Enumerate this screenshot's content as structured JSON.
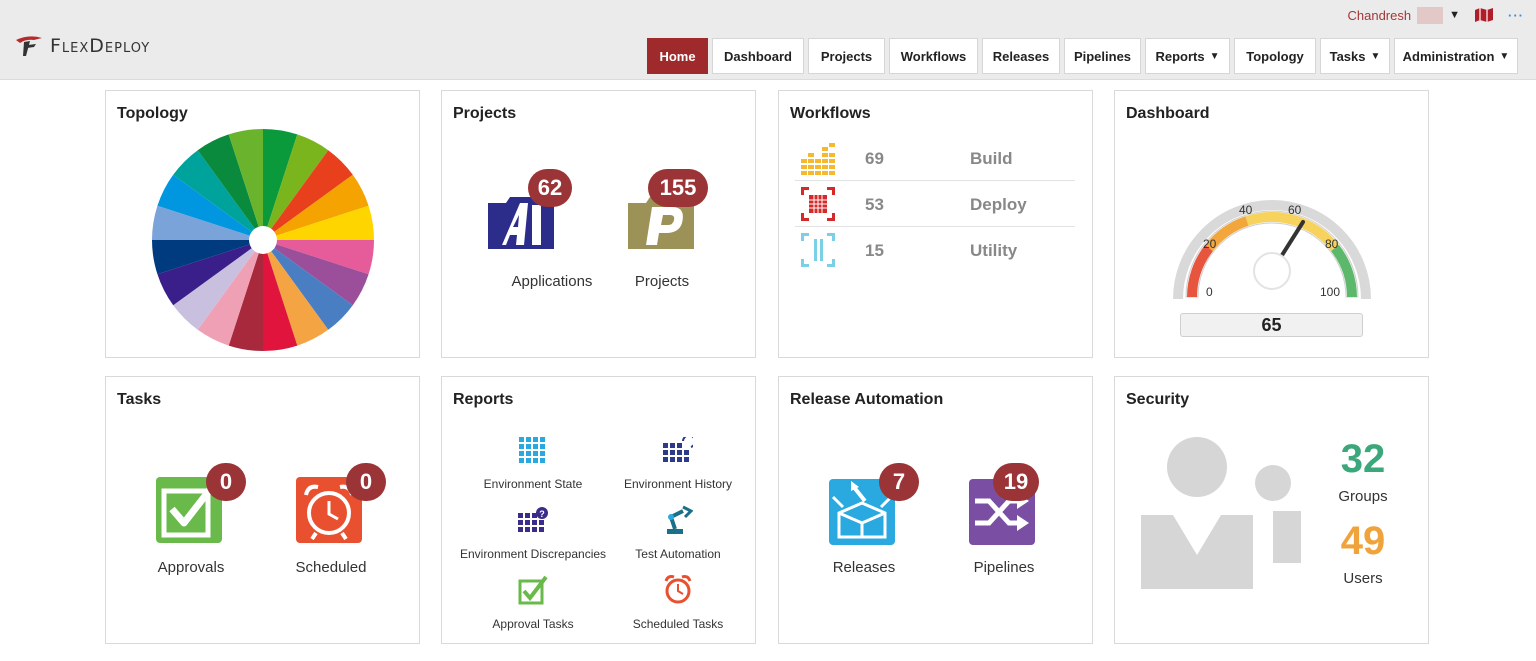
{
  "header": {
    "app_name": "FlexDeploy",
    "user_name": "Chandresh",
    "nav": [
      {
        "label": "Home",
        "active": true
      },
      {
        "label": "Dashboard"
      },
      {
        "label": "Projects"
      },
      {
        "label": "Workflows"
      },
      {
        "label": "Releases"
      },
      {
        "label": "Pipelines"
      },
      {
        "label": "Reports",
        "dropdown": true
      },
      {
        "label": "Topology"
      },
      {
        "label": "Tasks",
        "dropdown": true
      },
      {
        "label": "Administration",
        "dropdown": true
      }
    ],
    "icons": [
      "dropdown-caret-icon",
      "map-icon",
      "more-icon"
    ]
  },
  "colors": {
    "accent": "#9e2a2b",
    "badge": "#9b3436",
    "groups": "#3aa87a",
    "users": "#f0a33a"
  },
  "tiles": {
    "topology": {
      "title": "Topology"
    },
    "projects": {
      "title": "Projects",
      "applications": {
        "label": "Applications",
        "count": "62"
      },
      "projects": {
        "label": "Projects",
        "count": "155"
      }
    },
    "workflows": {
      "title": "Workflows",
      "rows": [
        {
          "name": "Build",
          "count": "69"
        },
        {
          "name": "Deploy",
          "count": "53"
        },
        {
          "name": "Utility",
          "count": "15"
        }
      ]
    },
    "dashboard": {
      "title": "Dashboard",
      "gauge": {
        "value": "65",
        "ticks": [
          "0",
          "20",
          "40",
          "60",
          "80",
          "100"
        ]
      }
    },
    "tasks": {
      "title": "Tasks",
      "approvals": {
        "label": "Approvals",
        "count": "0"
      },
      "scheduled": {
        "label": "Scheduled",
        "count": "0"
      }
    },
    "reports": {
      "title": "Reports",
      "items": [
        "Environment State",
        "Environment History",
        "Environment Discrepancies",
        "Test Automation",
        "Approval Tasks",
        "Scheduled Tasks"
      ]
    },
    "release_automation": {
      "title": "Release Automation",
      "releases": {
        "label": "Releases",
        "count": "7"
      },
      "pipelines": {
        "label": "Pipelines",
        "count": "19"
      }
    },
    "security": {
      "title": "Security",
      "groups": {
        "label": "Groups",
        "count": "32"
      },
      "users": {
        "label": "Users",
        "count": "49"
      }
    }
  }
}
